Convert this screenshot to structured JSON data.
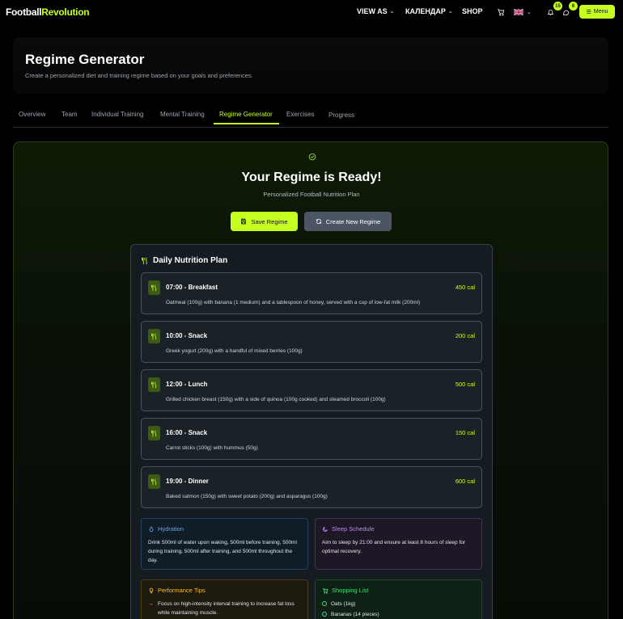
{
  "nav": {
    "logo_a": "Football",
    "logo_b": "Revolution",
    "view_as": "VIEW AS",
    "calendar": "КАЛЕНДАР",
    "shop": "SHOP",
    "notifications_count": "15",
    "messages_count": "6",
    "menu_label": "Menu"
  },
  "header": {
    "title": "Regime Generator",
    "subtitle": "Create a personalized diet and training regime based on your goals and preferences."
  },
  "tabs": [
    {
      "label": "Overview"
    },
    {
      "label": "Team"
    },
    {
      "label": "Individual Training"
    },
    {
      "label": "Mental Training"
    },
    {
      "label": "Regime Generator"
    },
    {
      "label": "Exercises"
    },
    {
      "label": "Progress"
    }
  ],
  "result": {
    "title": "Your Regime is Ready!",
    "subtitle": "Personalized Football Nutrition Plan",
    "save_label": "Save Regime",
    "new_label": "Create New Regime"
  },
  "plan": {
    "title": "Daily Nutrition Plan",
    "meals": [
      {
        "title": "07:00 - Breakfast",
        "cal": "450 cal",
        "desc": "Oatmeal (100g) with banana (1 medium) and a tablespoon of honey, served with a cup of low-fat milk (200ml)"
      },
      {
        "title": "10:00 - Snack",
        "cal": "200 cal",
        "desc": "Greek yogurt (200g) with a handful of mixed berries (100g)"
      },
      {
        "title": "12:00 - Lunch",
        "cal": "500 cal",
        "desc": "Grilled chicken breast (150g) with a side of quinoa (100g cooked) and steamed broccoli (100g)"
      },
      {
        "title": "16:00 - Snack",
        "cal": "150 cal",
        "desc": "Carrot sticks (100g) with hummus (50g)"
      },
      {
        "title": "19:00 - Dinner",
        "cal": "600 cal",
        "desc": "Baked salmon (150g) with sweet potato (200g) and asparagus (100g)"
      }
    ],
    "hydration": {
      "title": "Hydration",
      "text": "Drink 500ml of water upon waking, 500ml before training, 500ml during training, 500ml after training, and 500ml throughout the day."
    },
    "sleep": {
      "title": "Sleep Schedule",
      "text": "Aim to sleep by 21:00 and ensure at least 8 hours of sleep for optimal recovery."
    },
    "performance": {
      "title": "Performance Tips",
      "items": [
        "Focus on high-intensity interval training to increase fat loss while maintaining muscle."
      ]
    },
    "shopping": {
      "title": "Shopping List",
      "items": [
        "Oats (1kg)",
        "Bananas (14 pieces)"
      ]
    }
  },
  "colors": {
    "accent": "#c5ff1f"
  }
}
